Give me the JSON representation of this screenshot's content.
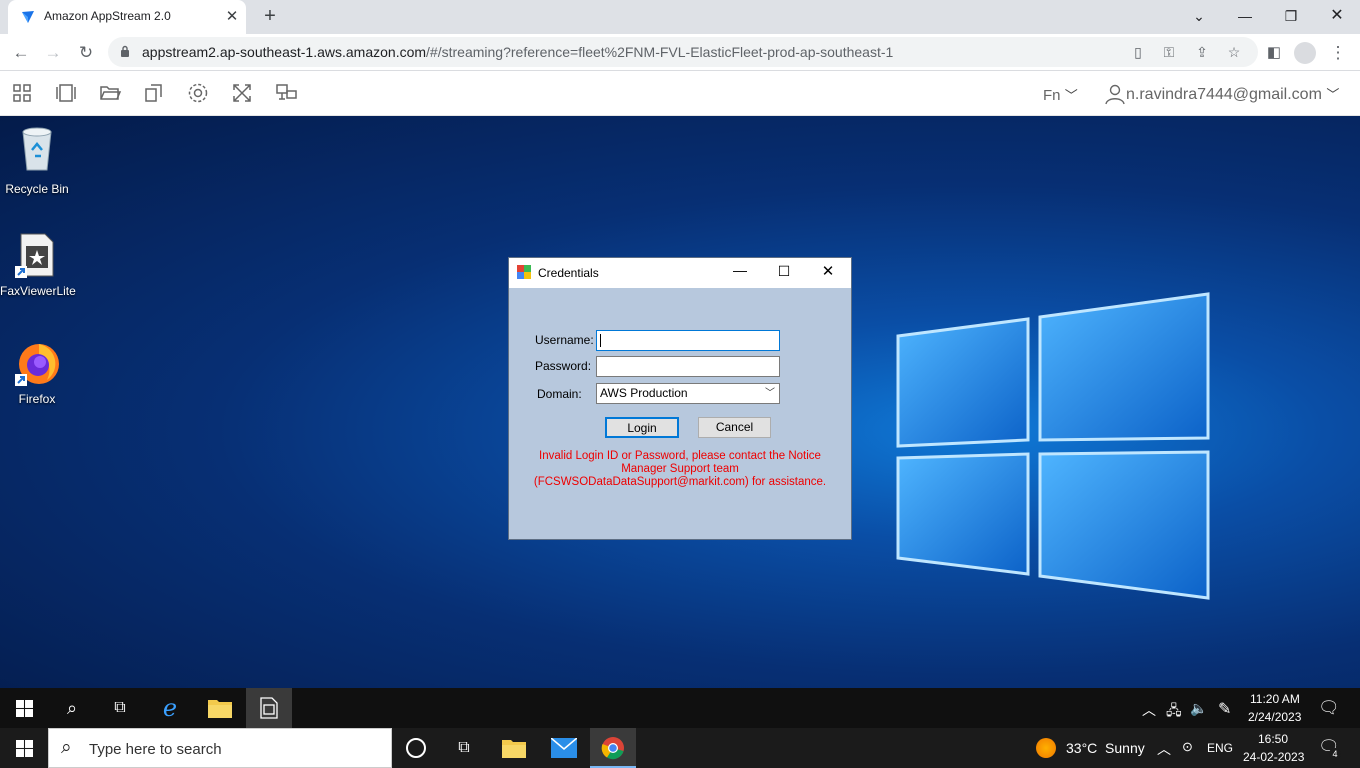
{
  "browser": {
    "tab_title": "Amazon AppStream 2.0",
    "url_host": "appstream2.ap-southeast-1.aws.amazon.com",
    "url_path": "/#/streaming?reference=fleet%2FNM-FVL-ElasticFleet-prod-ap-southeast-1"
  },
  "appstream_toolbar": {
    "icons": [
      "apps-icon",
      "windows-icon",
      "folder-icon",
      "clipboard-icon",
      "settings-icon",
      "fullscreen-icon",
      "display-icon"
    ],
    "fn_label": "Fn",
    "user_email": "n.ravindra7444@gmail.com"
  },
  "desktop": {
    "icons": [
      {
        "label": "Recycle Bin"
      },
      {
        "label": "FaxViewerLite"
      },
      {
        "label": "Firefox"
      }
    ]
  },
  "dialog": {
    "title": "Credentials",
    "username_label": "Username:",
    "username_value": "",
    "password_label": "Password:",
    "password_value": "",
    "domain_label": "Domain:",
    "domain_value": "AWS Production",
    "login_label": "Login",
    "cancel_label": "Cancel",
    "error_line1": "Invalid Login ID or Password, please contact the Notice",
    "error_line2": "Manager Support team",
    "error_line3": "(FCSWSODataDataSupport@markit.com) for assistance."
  },
  "remote_taskbar": {
    "time": "11:20 AM",
    "date": "2/24/2023"
  },
  "local_taskbar": {
    "search_placeholder": "Type here to search",
    "weather": "33°C  Sunny",
    "lang": "ENG",
    "time": "16:50",
    "date": "24-02-2023",
    "notifications": "4"
  },
  "colors": {
    "accent": "#0078d7",
    "error": "#ee0000",
    "dialog_bg": "#b7c8dd"
  }
}
